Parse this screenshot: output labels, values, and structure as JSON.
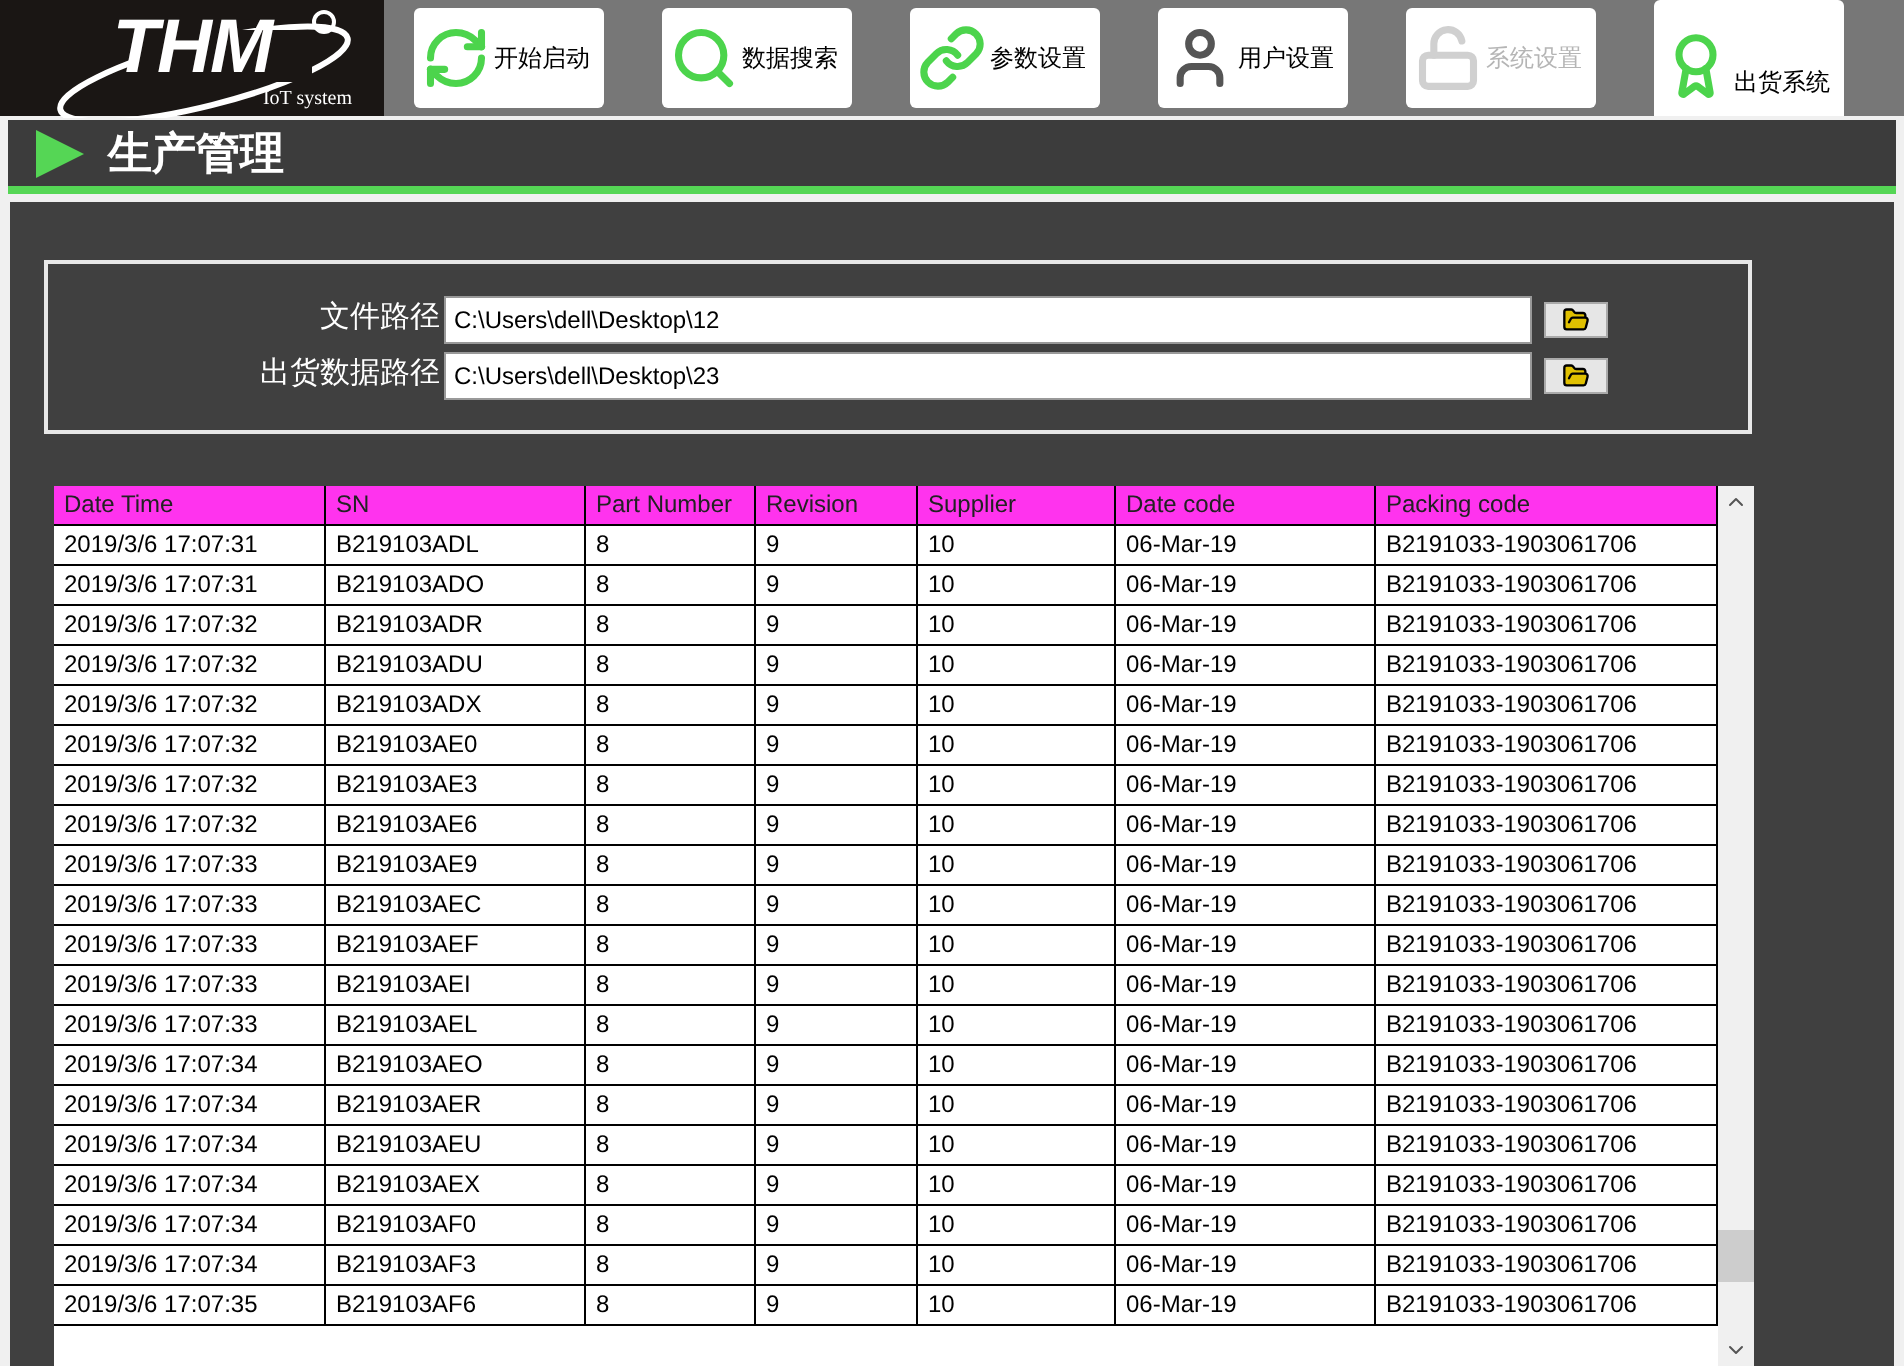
{
  "logo": {
    "text": "THM",
    "subtitle": "IoT system"
  },
  "tabs": [
    {
      "label": "开始启动",
      "selected": false,
      "disabled": false
    },
    {
      "label": "数据搜索",
      "selected": false,
      "disabled": false
    },
    {
      "label": "参数设置",
      "selected": false,
      "disabled": false
    },
    {
      "label": "用户设置",
      "selected": false,
      "disabled": false
    },
    {
      "label": "系统设置",
      "selected": false,
      "disabled": true
    },
    {
      "label": "出货系统",
      "selected": true,
      "disabled": false
    }
  ],
  "page_title": "生产管理",
  "paths": [
    {
      "label": "文件路径",
      "value": "C:\\Users\\dell\\Desktop\\12"
    },
    {
      "label": "出货数据路径",
      "value": "C:\\Users\\dell\\Desktop\\23"
    }
  ],
  "table": {
    "columns": [
      "Date Time",
      "SN",
      "Part Number",
      "Revision",
      "Supplier",
      "Date code",
      "Packing code"
    ],
    "rows": [
      [
        "2019/3/6 17:07:31",
        "B219103ADL",
        "8",
        "9",
        "10",
        "06-Mar-19",
        "B2191033-1903061706"
      ],
      [
        "2019/3/6 17:07:31",
        "B219103ADO",
        "8",
        "9",
        "10",
        "06-Mar-19",
        "B2191033-1903061706"
      ],
      [
        "2019/3/6 17:07:32",
        "B219103ADR",
        "8",
        "9",
        "10",
        "06-Mar-19",
        "B2191033-1903061706"
      ],
      [
        "2019/3/6 17:07:32",
        "B219103ADU",
        "8",
        "9",
        "10",
        "06-Mar-19",
        "B2191033-1903061706"
      ],
      [
        "2019/3/6 17:07:32",
        "B219103ADX",
        "8",
        "9",
        "10",
        "06-Mar-19",
        "B2191033-1903061706"
      ],
      [
        "2019/3/6 17:07:32",
        "B219103AE0",
        "8",
        "9",
        "10",
        "06-Mar-19",
        "B2191033-1903061706"
      ],
      [
        "2019/3/6 17:07:32",
        "B219103AE3",
        "8",
        "9",
        "10",
        "06-Mar-19",
        "B2191033-1903061706"
      ],
      [
        "2019/3/6 17:07:32",
        "B219103AE6",
        "8",
        "9",
        "10",
        "06-Mar-19",
        "B2191033-1903061706"
      ],
      [
        "2019/3/6 17:07:33",
        "B219103AE9",
        "8",
        "9",
        "10",
        "06-Mar-19",
        "B2191033-1903061706"
      ],
      [
        "2019/3/6 17:07:33",
        "B219103AEC",
        "8",
        "9",
        "10",
        "06-Mar-19",
        "B2191033-1903061706"
      ],
      [
        "2019/3/6 17:07:33",
        "B219103AEF",
        "8",
        "9",
        "10",
        "06-Mar-19",
        "B2191033-1903061706"
      ],
      [
        "2019/3/6 17:07:33",
        "B219103AEI",
        "8",
        "9",
        "10",
        "06-Mar-19",
        "B2191033-1903061706"
      ],
      [
        "2019/3/6 17:07:33",
        "B219103AEL",
        "8",
        "9",
        "10",
        "06-Mar-19",
        "B2191033-1903061706"
      ],
      [
        "2019/3/6 17:07:34",
        "B219103AEO",
        "8",
        "9",
        "10",
        "06-Mar-19",
        "B2191033-1903061706"
      ],
      [
        "2019/3/6 17:07:34",
        "B219103AER",
        "8",
        "9",
        "10",
        "06-Mar-19",
        "B2191033-1903061706"
      ],
      [
        "2019/3/6 17:07:34",
        "B219103AEU",
        "8",
        "9",
        "10",
        "06-Mar-19",
        "B2191033-1903061706"
      ],
      [
        "2019/3/6 17:07:34",
        "B219103AEX",
        "8",
        "9",
        "10",
        "06-Mar-19",
        "B2191033-1903061706"
      ],
      [
        "2019/3/6 17:07:34",
        "B219103AF0",
        "8",
        "9",
        "10",
        "06-Mar-19",
        "B2191033-1903061706"
      ],
      [
        "2019/3/6 17:07:34",
        "B219103AF3",
        "8",
        "9",
        "10",
        "06-Mar-19",
        "B2191033-1903061706"
      ],
      [
        "2019/3/6 17:07:35",
        "B219103AF6",
        "8",
        "9",
        "10",
        "06-Mar-19",
        "B2191033-1903061706"
      ]
    ]
  }
}
